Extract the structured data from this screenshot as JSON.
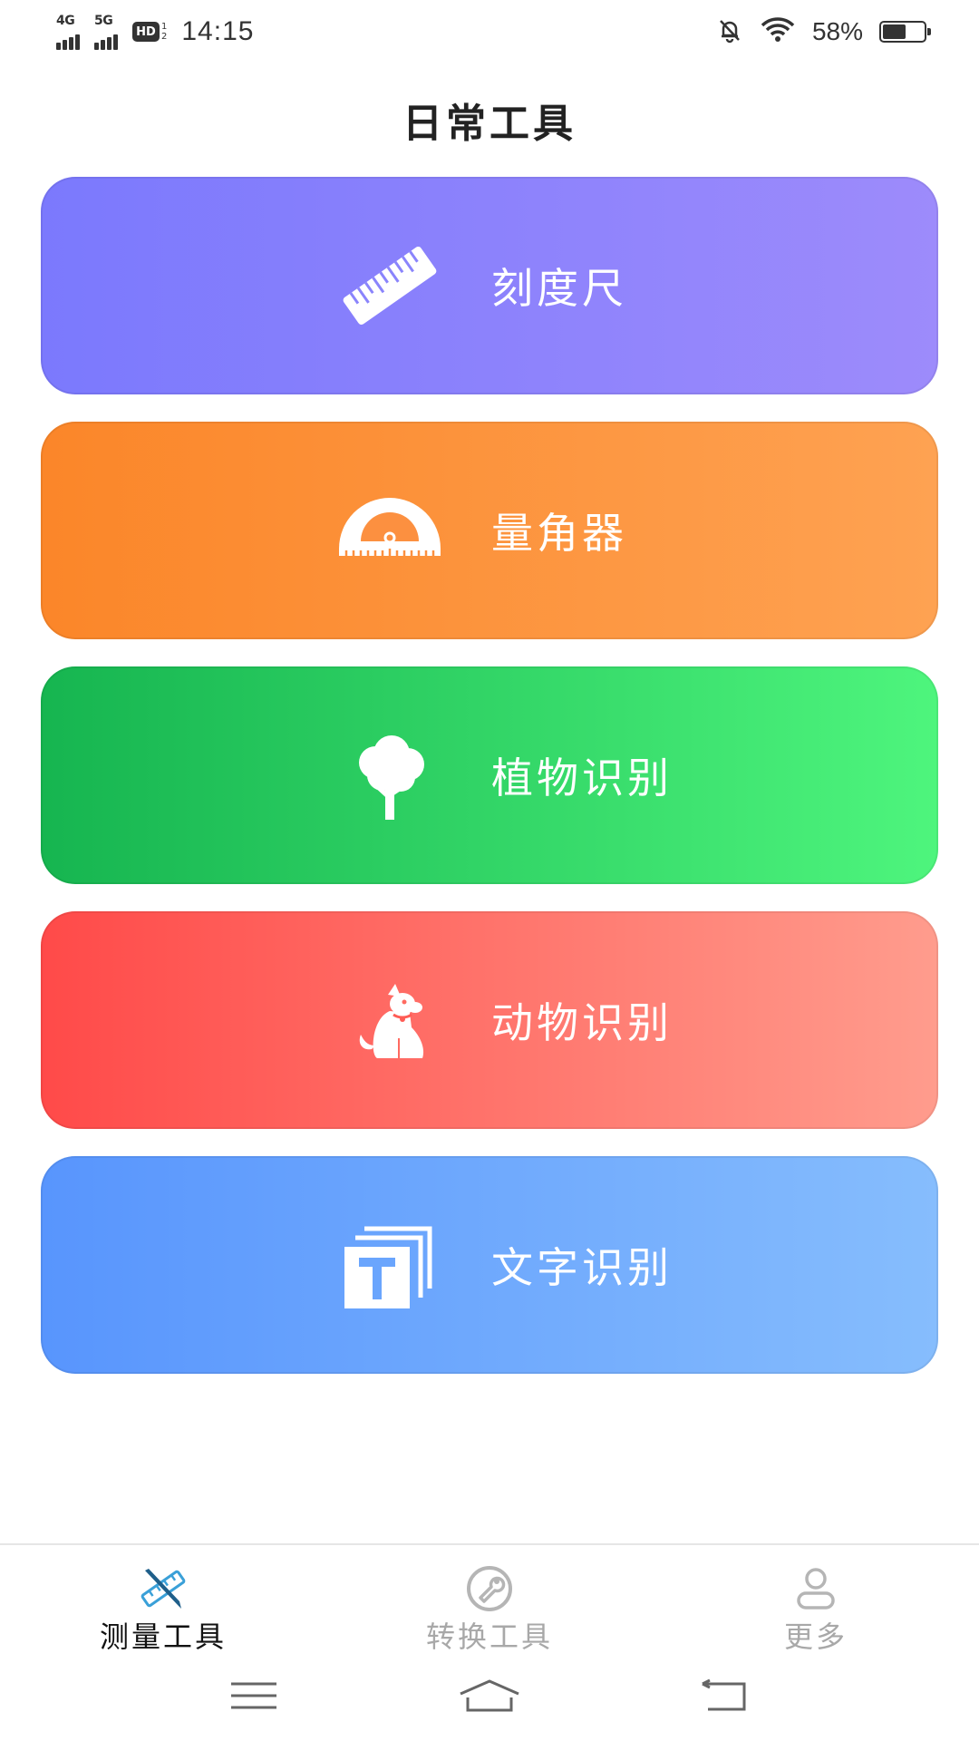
{
  "status_bar": {
    "net1": "4G",
    "net2": "5G",
    "hd": "HD",
    "hd_sub_top": "1",
    "hd_sub_bottom": "2",
    "time": "14:15",
    "battery_percent_text": "58%",
    "battery_level": 0.58
  },
  "header": {
    "title": "日常工具"
  },
  "tools": [
    {
      "label": "刻度尺",
      "icon": "ruler-icon",
      "gradient": [
        "#7b79fd",
        "#9d8bfb"
      ]
    },
    {
      "label": "量角器",
      "icon": "protractor-icon",
      "gradient": [
        "#fb8629",
        "#fea252"
      ]
    },
    {
      "label": "植物识别",
      "icon": "tree-icon",
      "gradient": [
        "#16b550",
        "#4ef57d"
      ]
    },
    {
      "label": "动物识别",
      "icon": "dog-icon",
      "gradient": [
        "#ff4a49",
        "#ff9c8d"
      ]
    },
    {
      "label": "文字识别",
      "icon": "text-recognition-icon",
      "gradient": [
        "#5895fd",
        "#86bdfd"
      ]
    }
  ],
  "bottom_nav": [
    {
      "label": "测量工具",
      "icon": "measure-tools-icon",
      "active": true,
      "accent": "#3aa0d8"
    },
    {
      "label": "转换工具",
      "icon": "wrench-icon",
      "active": false
    },
    {
      "label": "更多",
      "icon": "user-icon",
      "active": false
    }
  ],
  "system_nav": [
    "menu-icon",
    "home-icon",
    "back-icon"
  ]
}
